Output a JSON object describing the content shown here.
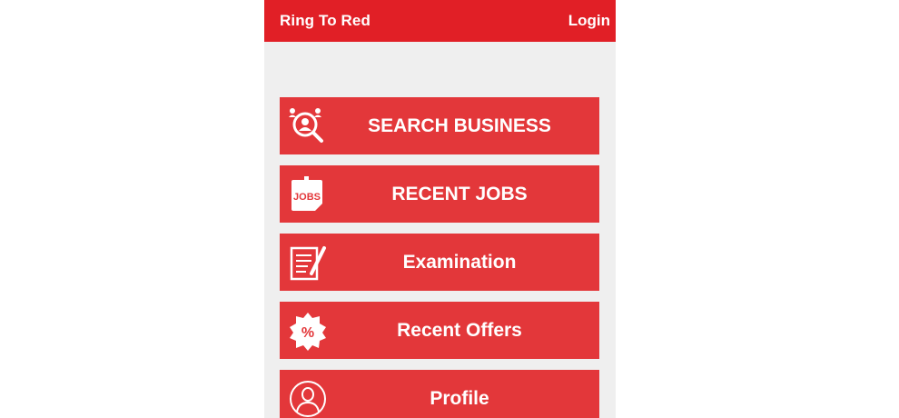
{
  "appbar": {
    "title": "Ring To Red",
    "login_label": "Login"
  },
  "menu": {
    "items": [
      {
        "label": "SEARCH BUSINESS",
        "icon": "search-business-icon"
      },
      {
        "label": "RECENT JOBS",
        "icon": "jobs-icon"
      },
      {
        "label": "Examination",
        "icon": "examination-icon"
      },
      {
        "label": "Recent Offers",
        "icon": "offers-icon"
      },
      {
        "label": "Profile",
        "icon": "profile-icon"
      }
    ]
  },
  "colors": {
    "primary": "#e11f26",
    "button": "#e3373a",
    "background": "#efefef"
  }
}
